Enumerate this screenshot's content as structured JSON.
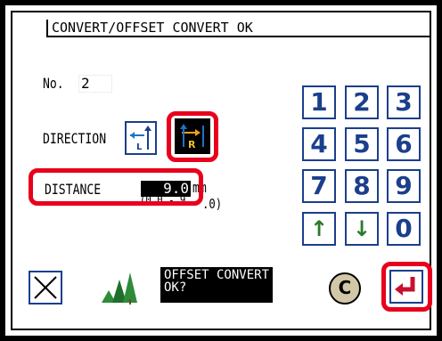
{
  "title": "CONVERT/OFFSET CONVERT OK",
  "no_label": "No.",
  "no_value": "2",
  "direction_label": "DIRECTION",
  "direction_left_letter": "L",
  "direction_right_letter": "R",
  "distance_label": "DISTANCE",
  "distance_value": "9.0",
  "distance_unit": "mm",
  "distance_range_partial": "(0.0 - 9",
  "distance_range_tail": ".0)",
  "keypad": [
    "1",
    "2",
    "3",
    "4",
    "5",
    "6",
    "7",
    "8",
    "9"
  ],
  "key_up": "↑",
  "key_down": "↓",
  "key_zero": "0",
  "message": "OFFSET CONVERT\nOK?",
  "clear_label": "C",
  "selected_direction": "R",
  "colors": {
    "key_blue": "#1a3f8c",
    "highlight_red": "#e8001c",
    "arrow_green": "#2a7a2a",
    "enter_red": "#c8102e"
  }
}
